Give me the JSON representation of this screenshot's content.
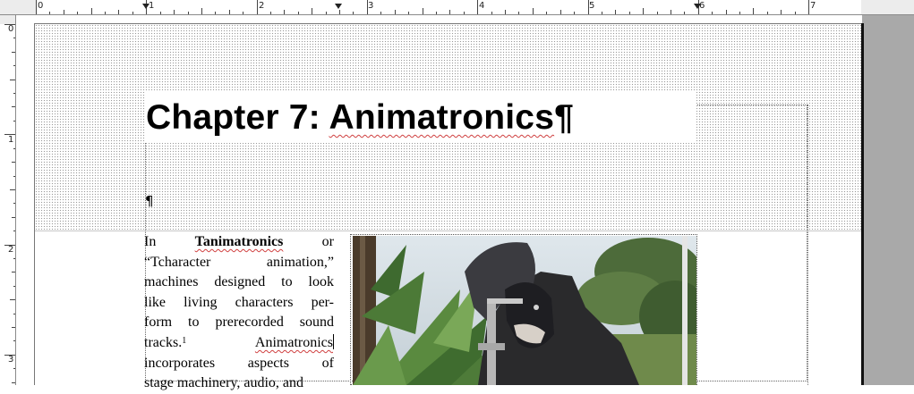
{
  "ruler": {
    "numbers": [
      "0",
      "1",
      "2",
      "3",
      "4",
      "5",
      "6",
      "7"
    ],
    "vertical_numbers": [
      "0",
      "1",
      "2",
      "3"
    ]
  },
  "title": {
    "prefix": "Chapter 7: ",
    "word": "Animatronics",
    "mark": "¶"
  },
  "pilcrow": "¶",
  "body": {
    "lines": [
      [
        "In",
        "Tanimatronics",
        "or"
      ],
      [
        "“Tcharacter",
        "animation,”"
      ],
      [
        "machines",
        "designed",
        "to",
        "look"
      ],
      [
        "like",
        "living",
        "characters",
        "per-"
      ],
      [
        "form",
        "to",
        "prerecorded",
        "sound"
      ],
      [
        "tracks.",
        "Animatronics"
      ],
      [
        "incorporates",
        "aspects",
        "of"
      ],
      [
        "stage machinery, audio, and"
      ]
    ],
    "footnote_ref": "1"
  },
  "photo": {
    "icon": "animatronic-gorilla-photo"
  },
  "colors": {
    "spell_squiggle": "#d04040",
    "page_gray": "#a9a9a9"
  }
}
